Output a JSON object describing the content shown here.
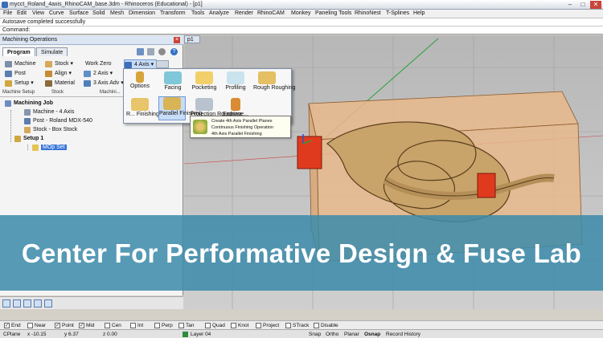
{
  "window": {
    "title": "mycct_Roland_4axis_RhinoCAM_base.3dm - Rhinoceros (Educational) - [p1]",
    "controls": [
      "–",
      "□",
      "✕"
    ]
  },
  "menubar": [
    "File",
    "Edit",
    "View",
    "Curve",
    "Surface",
    "Solid",
    "Mesh",
    "Dimension",
    "Transform",
    "Tools",
    "Analyze",
    "Render",
    "RhinoCAM",
    "Monkey",
    "Paneling Tools",
    "RhinoNest",
    "T-Splines",
    "Help"
  ],
  "command_history": "Autosave completed successfully",
  "command_prompt": "Command:",
  "panel": {
    "title": "Machining Operations",
    "tabs": [
      "Program",
      "Simulate"
    ],
    "ribbon": {
      "machine": "Machine",
      "post": "Post",
      "setup": "Setup ▾",
      "stock": "Stock ▾",
      "align": "Align ▾",
      "material": "Material",
      "work_zero": "Work Zero",
      "axis2": "2 Axis ▾",
      "axis3": "3 Axis Adv ▾",
      "axis4": "4 Axis ▾",
      "group_machine_setup": "Machine Setup",
      "group_stock": "Stock",
      "group_machining": "Machini..."
    },
    "tree": {
      "root": "Machining Job",
      "machine": "Machine - 4 Axis",
      "post": "Post - Roland MDX-540",
      "stock": "Stock - Box Stock",
      "setup": "Setup 1",
      "mop_set": "MOp Set"
    }
  },
  "viewport": {
    "tab": "p1",
    "colors": {
      "stock_box": "#e7b98b",
      "model": "#c8a36a",
      "axis_red": "#e03a1e",
      "axis_green": "#2aa13a"
    }
  },
  "popup": {
    "items": [
      {
        "label": "Options"
      },
      {
        "label": "Facing"
      },
      {
        "label": "Pocketing"
      },
      {
        "label": "Profiling"
      },
      {
        "label": "Rough Roughing"
      },
      {
        "label": "R... Finishing"
      },
      {
        "label": "Parallel Finishing"
      },
      {
        "label": "Projection Roughing"
      },
      {
        "label": "Engrave..."
      }
    ],
    "tooltip": [
      "Create 4th Axis Parallel Planes",
      "Continuous Finishing Operation",
      "4th Axis Parallel Finishing"
    ]
  },
  "banner": {
    "text": "Center For Performative Design & Fuse Lab",
    "color": "#3b8aaa"
  },
  "osnaps": [
    {
      "label": "End",
      "checked": true
    },
    {
      "label": "Near",
      "checked": false
    },
    {
      "label": "Point",
      "checked": true
    },
    {
      "label": "Mid",
      "checked": true
    },
    {
      "label": "Cen",
      "checked": false
    },
    {
      "label": "Int",
      "checked": false
    },
    {
      "label": "Perp",
      "checked": false
    },
    {
      "label": "Tan",
      "checked": false
    },
    {
      "label": "Quad",
      "checked": false
    },
    {
      "label": "Knot",
      "checked": false
    },
    {
      "label": "Project",
      "checked": false
    },
    {
      "label": "STrack",
      "checked": false
    },
    {
      "label": "Disable",
      "checked": false
    }
  ],
  "statusbar": {
    "cplane": "CPlane",
    "x": "x -10.15",
    "y": "y 6.37",
    "z": "z 0.00",
    "layer": "Layer 04",
    "snap": "Snap",
    "ortho": "Ortho",
    "planar": "Planar",
    "osnap": "Osnap",
    "record_history": "Record History"
  }
}
